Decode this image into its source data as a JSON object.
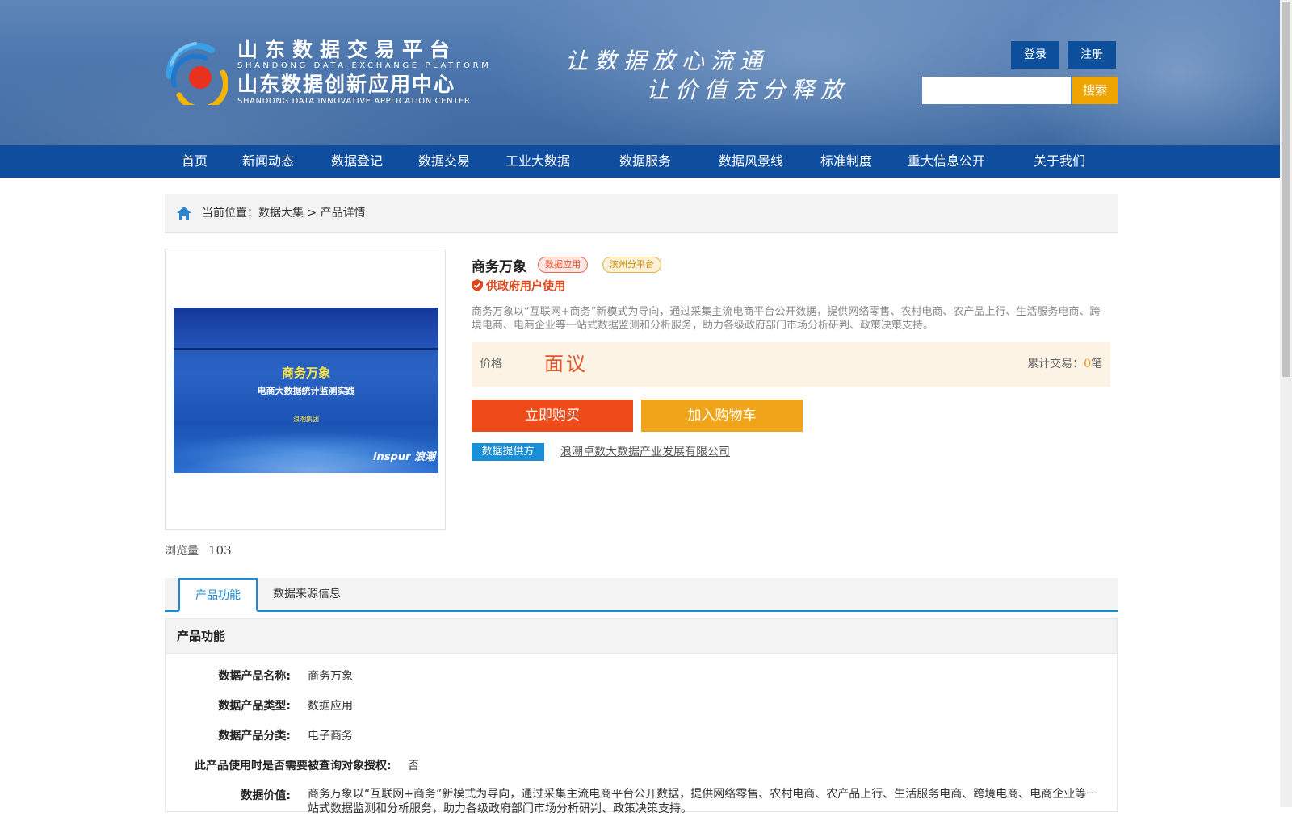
{
  "header": {
    "logo": {
      "title_cn": "山东数据交易平台",
      "title_en": "SHANDONG DATA EXCHANGE PLATFORM",
      "center_cn": "山东数据创新应用中心",
      "center_en": "SHANDONG DATA INNOVATIVE APPLICATION CENTER"
    },
    "slogan_line1": "让数据放心流通",
    "slogan_line2": "让价值充分释放",
    "login_label": "登录",
    "register_label": "注册",
    "search": {
      "value": "",
      "button_label": "搜索"
    }
  },
  "nav": {
    "items": [
      {
        "label": "首页"
      },
      {
        "label": "新闻动态"
      },
      {
        "label": "数据登记"
      },
      {
        "label": "数据交易"
      },
      {
        "label": "工业大数据"
      },
      {
        "label": "数据服务"
      },
      {
        "label": "数据风景线"
      },
      {
        "label": "标准制度"
      },
      {
        "label": "重大信息公开"
      },
      {
        "label": "关于我们"
      }
    ]
  },
  "breadcrumb": {
    "prefix": "当前位置：",
    "path": "数据大集 > 产品详情"
  },
  "product_image": {
    "title": "商务万象",
    "subtitle": "电商大数据统计监测实践",
    "org": "浪潮集团",
    "brand": "inspur 浪潮"
  },
  "views": {
    "label": "浏览量",
    "count": "103"
  },
  "product": {
    "title": "商务万象",
    "tags": [
      "数据应用",
      "滨州分平台"
    ],
    "gov_use": "供政府用户使用",
    "description": "商务万象以“互联网+商务”新模式为导向，通过采集主流电商平台公开数据，提供网络零售、农村电商、农产品上行、生活服务电商、跨境电商、电商企业等一站式数据监测和分析服务，助力各级政府部门市场分析研判、政策决策支持。",
    "price_label": "价格",
    "price_value": "面议",
    "deals_label": "累计交易：",
    "deals_count": "0",
    "deals_unit": "笔",
    "buy_label": "立即购买",
    "cart_label": "加入购物车",
    "provider_badge": "数据提供方",
    "provider_name": "浪潮卓数大数据产业发展有限公司"
  },
  "tabs": [
    {
      "label": "产品功能",
      "active": true
    },
    {
      "label": "数据来源信息",
      "active": false
    }
  ],
  "function_panel": {
    "header": "产品功能",
    "rows": [
      {
        "key": "数据产品名称:",
        "value": "商务万象"
      },
      {
        "key": "数据产品类型:",
        "value": "数据应用"
      },
      {
        "key": "数据产品分类:",
        "value": "电子商务"
      },
      {
        "key": "此产品使用时是否需要被查询对象授权:",
        "value": "否"
      },
      {
        "key": "数据价值:",
        "value": "商务万象以“互联网+商务”新模式为导向，通过采集主流电商平台公开数据，提供网络零售、农村电商、农产品上行、生活服务电商、跨境电商、电商企业等一站式数据监测和分析服务，助力各级政府部门市场分析研判、政策决策支持。"
      }
    ]
  },
  "colors": {
    "nav_bg": "#0f4e9e",
    "accent_orange": "#f0a400",
    "buy_red": "#ee4a1a",
    "tab_blue": "#1c8bd6"
  }
}
